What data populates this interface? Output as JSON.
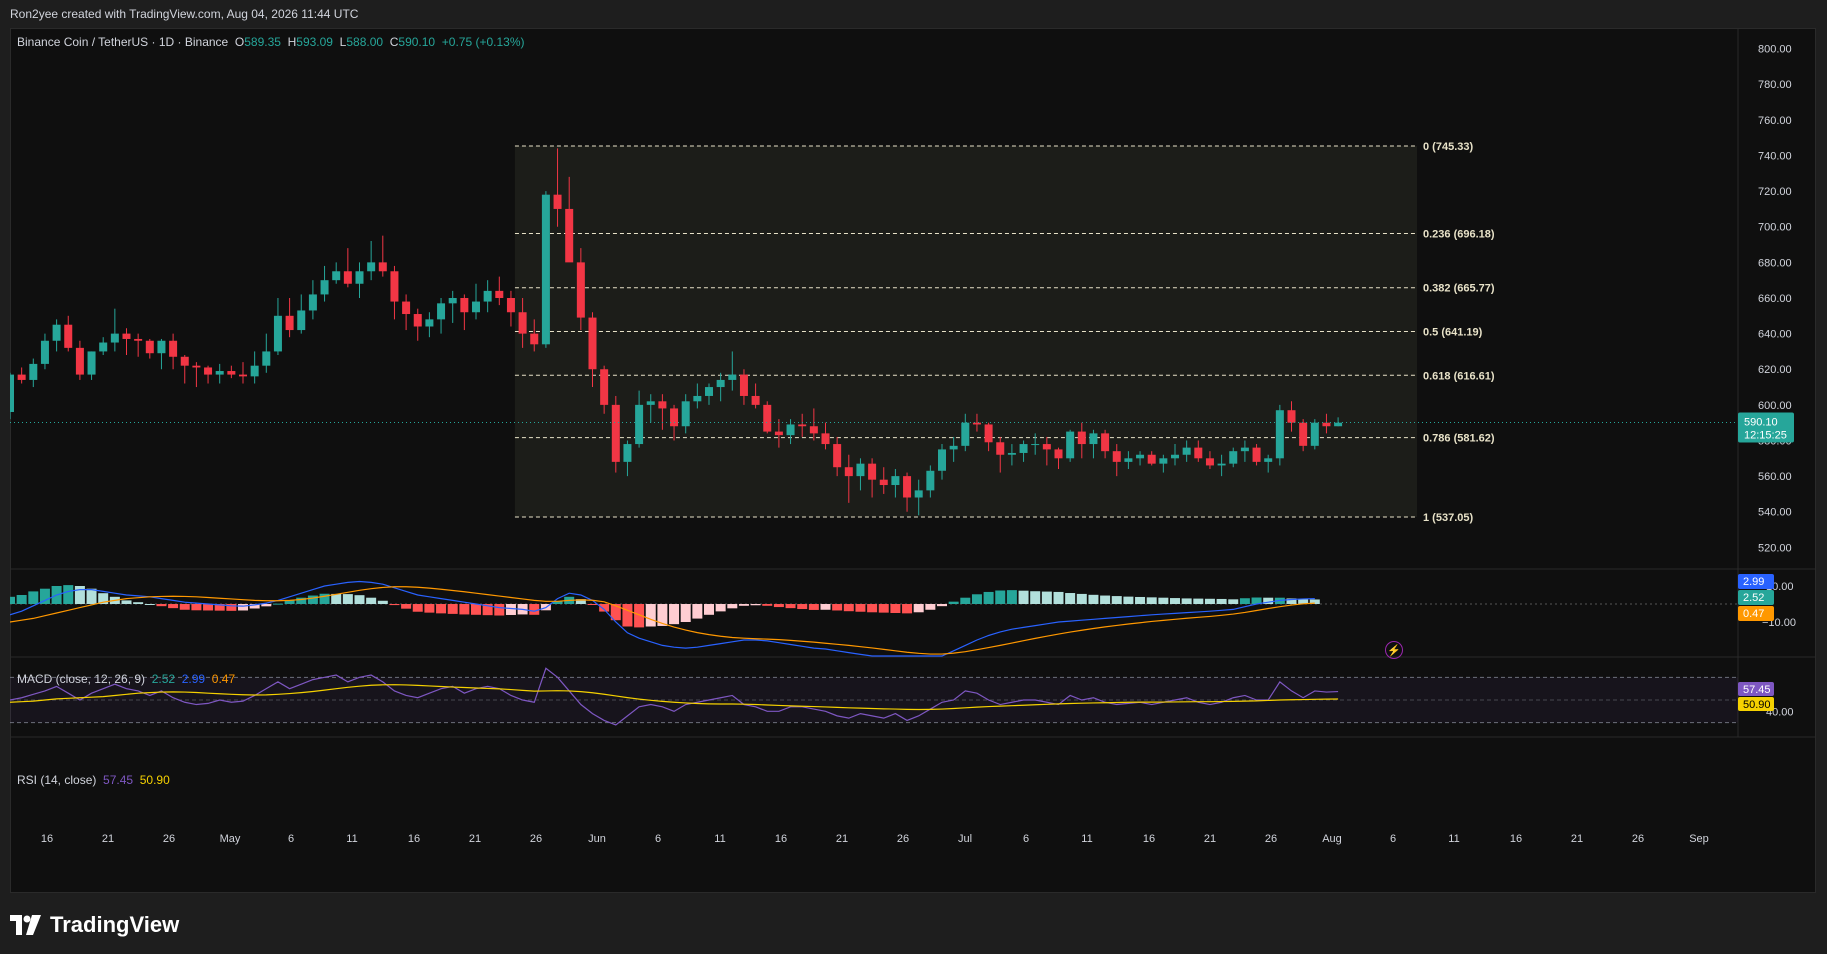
{
  "header": {
    "credit": "Ron2yee created with TradingView.com, Aug 04, 2026 11:44 UTC"
  },
  "symbol": {
    "name": "Binance Coin / TetherUS · 1D · Binance",
    "o_label": "O",
    "o": "589.35",
    "h_label": "H",
    "h": "593.09",
    "l_label": "L",
    "l": "588.00",
    "c_label": "C",
    "c": "590.10",
    "change": "+0.75 (+0.13%)"
  },
  "macd_legend": {
    "label": "MACD (close, 12, 26, 9)",
    "v1": "2.52",
    "v2": "2.99",
    "v3": "0.47"
  },
  "rsi_legend": {
    "label": "RSI (14, close)",
    "v1": "57.45",
    "v2": "50.90"
  },
  "footer": {
    "brand": "TradingView"
  },
  "colors": {
    "up": "#26a69a",
    "down": "#f23645",
    "macd": "#2962ff",
    "signal": "#ff9800",
    "rsi": "#7e57c2",
    "rsi_ma": "#f5d100"
  },
  "chart_data": {
    "type": "candlestick",
    "price_axis": {
      "ticks": [
        "800.00",
        "780.00",
        "760.00",
        "740.00",
        "720.00",
        "700.00",
        "680.00",
        "660.00",
        "640.00",
        "620.00",
        "600.00",
        "580.00",
        "560.00",
        "540.00",
        "520.00"
      ]
    },
    "date_axis": {
      "ticks": [
        "16",
        "21",
        "26",
        "May",
        "6",
        "11",
        "16",
        "21",
        "26",
        "Jun",
        "6",
        "11",
        "16",
        "21",
        "26",
        "Jul",
        "6",
        "11",
        "16",
        "21",
        "26",
        "Aug",
        "6",
        "11",
        "16",
        "21",
        "26",
        "Sep"
      ]
    },
    "last_price": {
      "value": "590.10",
      "countdown": "12:15:25"
    },
    "fib": [
      {
        "ratio": "0",
        "price": 745.33,
        "label": "0 (745.33)"
      },
      {
        "ratio": "0.236",
        "price": 696.18,
        "label": "0.236 (696.18)"
      },
      {
        "ratio": "0.382",
        "price": 665.77,
        "label": "0.382 (665.77)"
      },
      {
        "ratio": "0.5",
        "price": 641.19,
        "label": "0.5 (641.19)"
      },
      {
        "ratio": "0.618",
        "price": 616.61,
        "label": "0.618 (616.61)"
      },
      {
        "ratio": "0.786",
        "price": 581.62,
        "label": "0.786 (581.62)"
      },
      {
        "ratio": "1",
        "price": 537.05,
        "label": "1 (537.05)"
      }
    ],
    "ohlc": [
      [
        596,
        618,
        592,
        617
      ],
      [
        617,
        621,
        612,
        614
      ],
      [
        614,
        626,
        610,
        623
      ],
      [
        623,
        640,
        620,
        636
      ],
      [
        636,
        648,
        630,
        645
      ],
      [
        645,
        650,
        630,
        632
      ],
      [
        632,
        636,
        614,
        617
      ],
      [
        617,
        630,
        614,
        630
      ],
      [
        630,
        638,
        628,
        635
      ],
      [
        635,
        654,
        630,
        640
      ],
      [
        640,
        643,
        628,
        637
      ],
      [
        637,
        640,
        627,
        636
      ],
      [
        636,
        637,
        626,
        629
      ],
      [
        629,
        637,
        620,
        636
      ],
      [
        636,
        640,
        620,
        627
      ],
      [
        627,
        628,
        612,
        622
      ],
      [
        622,
        624,
        610,
        621
      ],
      [
        621,
        622,
        612,
        617
      ],
      [
        617,
        623,
        612,
        619
      ],
      [
        619,
        622,
        615,
        617
      ],
      [
        617,
        624,
        612,
        616
      ],
      [
        616,
        630,
        612,
        622
      ],
      [
        622,
        640,
        618,
        630
      ],
      [
        630,
        660,
        628,
        650
      ],
      [
        650,
        660,
        638,
        642
      ],
      [
        642,
        662,
        640,
        653
      ],
      [
        653,
        670,
        648,
        662
      ],
      [
        662,
        678,
        658,
        670
      ],
      [
        670,
        680,
        668,
        675
      ],
      [
        675,
        688,
        666,
        668
      ],
      [
        668,
        680,
        660,
        675
      ],
      [
        675,
        692,
        670,
        680
      ],
      [
        680,
        695,
        672,
        675
      ],
      [
        675,
        678,
        648,
        658
      ],
      [
        658,
        662,
        642,
        651
      ],
      [
        651,
        654,
        636,
        644
      ],
      [
        644,
        652,
        638,
        648
      ],
      [
        648,
        660,
        640,
        657
      ],
      [
        657,
        664,
        646,
        660
      ],
      [
        660,
        662,
        642,
        652
      ],
      [
        652,
        668,
        648,
        658
      ],
      [
        658,
        670,
        652,
        664
      ],
      [
        664,
        672,
        656,
        660
      ],
      [
        660,
        664,
        644,
        652
      ],
      [
        652,
        660,
        632,
        640
      ],
      [
        640,
        648,
        630,
        634
      ],
      [
        634,
        720,
        632,
        718
      ],
      [
        718,
        744,
        700,
        710
      ],
      [
        710,
        728,
        684,
        680
      ],
      [
        680,
        688,
        642,
        649
      ],
      [
        649,
        652,
        610,
        620
      ],
      [
        620,
        622,
        595,
        600
      ],
      [
        600,
        605,
        562,
        568
      ],
      [
        568,
        580,
        560,
        578
      ],
      [
        578,
        608,
        576,
        600
      ],
      [
        600,
        606,
        590,
        602
      ],
      [
        602,
        606,
        586,
        598
      ],
      [
        598,
        600,
        580,
        588
      ],
      [
        588,
        606,
        584,
        602
      ],
      [
        602,
        612,
        598,
        605
      ],
      [
        605,
        612,
        600,
        610
      ],
      [
        610,
        618,
        602,
        614
      ],
      [
        614,
        630,
        608,
        617
      ],
      [
        617,
        620,
        600,
        605
      ],
      [
        605,
        612,
        598,
        600
      ],
      [
        600,
        602,
        584,
        585
      ],
      [
        585,
        592,
        576,
        583
      ],
      [
        583,
        592,
        578,
        589
      ],
      [
        589,
        595,
        582,
        588
      ],
      [
        588,
        598,
        580,
        584
      ],
      [
        584,
        590,
        575,
        578
      ],
      [
        578,
        582,
        560,
        565
      ],
      [
        565,
        572,
        545,
        560
      ],
      [
        560,
        570,
        552,
        567
      ],
      [
        567,
        570,
        548,
        558
      ],
      [
        558,
        565,
        550,
        555
      ],
      [
        555,
        564,
        548,
        560
      ],
      [
        560,
        562,
        540,
        548
      ],
      [
        548,
        558,
        538,
        552
      ],
      [
        552,
        566,
        548,
        563
      ],
      [
        563,
        578,
        558,
        575
      ],
      [
        575,
        582,
        568,
        577
      ],
      [
        577,
        595,
        574,
        590
      ],
      [
        590,
        595,
        585,
        589
      ],
      [
        589,
        590,
        574,
        579
      ],
      [
        579,
        582,
        562,
        572
      ],
      [
        572,
        578,
        566,
        573
      ],
      [
        573,
        580,
        568,
        578
      ],
      [
        578,
        584,
        572,
        578
      ],
      [
        578,
        582,
        566,
        575
      ],
      [
        575,
        576,
        564,
        570
      ],
      [
        570,
        586,
        568,
        585
      ],
      [
        585,
        590,
        570,
        578
      ],
      [
        578,
        586,
        570,
        584
      ],
      [
        584,
        586,
        570,
        574
      ],
      [
        574,
        578,
        560,
        568
      ],
      [
        568,
        574,
        564,
        570
      ],
      [
        570,
        574,
        566,
        572
      ],
      [
        572,
        574,
        566,
        567
      ],
      [
        567,
        572,
        562,
        570
      ],
      [
        570,
        578,
        566,
        572
      ],
      [
        572,
        580,
        568,
        576
      ],
      [
        576,
        580,
        568,
        570
      ],
      [
        570,
        574,
        564,
        566
      ],
      [
        566,
        572,
        560,
        567
      ],
      [
        567,
        576,
        565,
        574
      ],
      [
        574,
        580,
        568,
        576
      ],
      [
        576,
        578,
        566,
        568
      ],
      [
        568,
        572,
        562,
        570
      ],
      [
        570,
        600,
        566,
        597
      ],
      [
        597,
        602,
        585,
        590
      ],
      [
        590,
        592,
        574,
        577
      ],
      [
        577,
        592,
        575,
        590
      ],
      [
        590,
        595,
        584,
        588
      ],
      [
        588,
        593,
        588,
        590
      ]
    ],
    "macd": {
      "name": "MACD (close, 12, 26, 9)",
      "macd": [
        -6,
        -4,
        -1,
        2,
        5,
        7,
        8,
        8,
        7,
        6,
        5,
        4.5,
        4,
        3,
        2,
        1,
        0.5,
        0,
        -0.5,
        -1,
        -1.2,
        -0.5,
        0.5,
        2,
        4,
        6,
        8,
        10,
        11,
        12,
        12.5,
        12,
        11,
        9,
        7,
        5,
        4,
        3,
        2,
        1,
        0,
        -1,
        -2,
        -2.5,
        -3,
        -4,
        -2,
        3,
        6,
        5,
        2,
        -3,
        -10,
        -16,
        -19,
        -21,
        -23,
        -24,
        -24.5,
        -24,
        -23,
        -22,
        -21,
        -20,
        -20,
        -20.5,
        -21.5,
        -22.5,
        -23.5,
        -24.5,
        -25,
        -26,
        -27,
        -28,
        -29,
        -30,
        -31,
        -32,
        -32,
        -31,
        -29,
        -26,
        -23,
        -20,
        -17.5,
        -15.5,
        -14,
        -13,
        -12,
        -11,
        -10,
        -9.5,
        -9,
        -8.5,
        -8,
        -7.5,
        -7,
        -6.5,
        -6,
        -5.6,
        -5.2,
        -4.8,
        -4.4,
        -4,
        -3.5,
        -3,
        -1.5,
        0,
        1,
        2,
        2.5,
        2.8,
        2.99
      ],
      "signal": [
        -10,
        -9,
        -8,
        -6.5,
        -5,
        -3.5,
        -2,
        -0.5,
        1,
        2,
        3,
        3.5,
        4,
        4.2,
        4.3,
        4.2,
        4,
        3.6,
        3.2,
        2.8,
        2.4,
        2,
        1.8,
        1.8,
        2,
        2.5,
        3.3,
        4.3,
        5.4,
        6.5,
        7.6,
        8.5,
        9.2,
        9.6,
        9.6,
        9.3,
        8.8,
        8.2,
        7.5,
        6.8,
        6,
        5.2,
        4.4,
        3.6,
        2.8,
        2,
        1.5,
        1.5,
        2,
        2.3,
        2.1,
        1.2,
        -1,
        -3.5,
        -6,
        -8.5,
        -10.8,
        -12.8,
        -14.5,
        -15.9,
        -17,
        -17.9,
        -18.6,
        -19,
        -19.3,
        -19.5,
        -19.8,
        -20.2,
        -20.7,
        -21.2,
        -21.8,
        -22.4,
        -23,
        -23.7,
        -24.4,
        -25.2,
        -26,
        -26.8,
        -27.4,
        -27.8,
        -27.8,
        -27.3,
        -26.5,
        -25.4,
        -24.2,
        -23,
        -21.7,
        -20.4,
        -19.1,
        -17.9,
        -16.7,
        -15.6,
        -14.6,
        -13.6,
        -12.7,
        -11.9,
        -11.1,
        -10.4,
        -9.7,
        -9.1,
        -8.5,
        -7.9,
        -7.4,
        -6.9,
        -6.3,
        -5.6,
        -4.7,
        -3.6,
        -2.5,
        -1.5,
        -0.6,
        0.1,
        0.47
      ]
    },
    "rsi": {
      "name": "RSI (14, close)",
      "rsi": [
        50,
        52,
        55,
        58,
        62,
        56,
        50,
        56,
        60,
        64,
        60,
        58,
        54,
        58,
        52,
        48,
        46,
        47,
        50,
        48,
        49,
        54,
        60,
        66,
        60,
        64,
        68,
        70,
        72,
        66,
        70,
        72,
        66,
        58,
        54,
        52,
        56,
        60,
        62,
        56,
        60,
        62,
        60,
        54,
        50,
        48,
        78,
        70,
        58,
        46,
        38,
        32,
        28,
        36,
        44,
        46,
        44,
        40,
        46,
        48,
        50,
        52,
        54,
        46,
        44,
        40,
        40,
        44,
        44,
        42,
        40,
        36,
        34,
        38,
        36,
        34,
        38,
        32,
        36,
        42,
        48,
        50,
        58,
        56,
        50,
        46,
        48,
        50,
        50,
        48,
        46,
        54,
        50,
        52,
        48,
        46,
        47,
        48,
        46,
        48,
        50,
        52,
        48,
        46,
        48,
        52,
        54,
        50,
        50,
        66,
        58,
        52,
        58,
        57,
        57.45
      ],
      "ma": [
        48,
        48.5,
        49,
        50,
        51,
        51.5,
        52,
        52.5,
        53,
        54,
        55,
        56,
        56.5,
        57,
        57.2,
        57,
        56.6,
        56,
        55.5,
        55,
        54.6,
        54.4,
        54.5,
        55,
        55.7,
        56.5,
        57.5,
        58.7,
        60,
        61.2,
        62.2,
        63,
        63.4,
        63.5,
        63.3,
        62.9,
        62.4,
        61.9,
        61.4,
        61,
        60.6,
        60.2,
        59.8,
        59.2,
        58.5,
        57.8,
        58,
        58.2,
        58,
        57.4,
        56.4,
        55.1,
        53.6,
        52.1,
        50.8,
        49.7,
        48.8,
        48,
        47.4,
        46.9,
        46.6,
        46.5,
        46.5,
        46.3,
        46,
        45.6,
        45.2,
        44.8,
        44.5,
        44.2,
        43.9,
        43.5,
        43.1,
        42.8,
        42.5,
        42.2,
        42,
        41.7,
        41.6,
        41.7,
        42,
        42.5,
        43.1,
        43.7,
        44.2,
        44.6,
        45,
        45.4,
        45.8,
        46.2,
        46.6,
        46.9,
        47.2,
        47.4,
        47.6,
        47.8,
        48,
        48.1,
        48.1,
        48.2,
        48.3,
        48.4,
        48.5,
        48.5,
        48.6,
        48.8,
        49,
        49.2,
        49.6,
        50,
        50.2,
        50.4,
        50.6,
        50.8,
        50.9
      ]
    }
  }
}
